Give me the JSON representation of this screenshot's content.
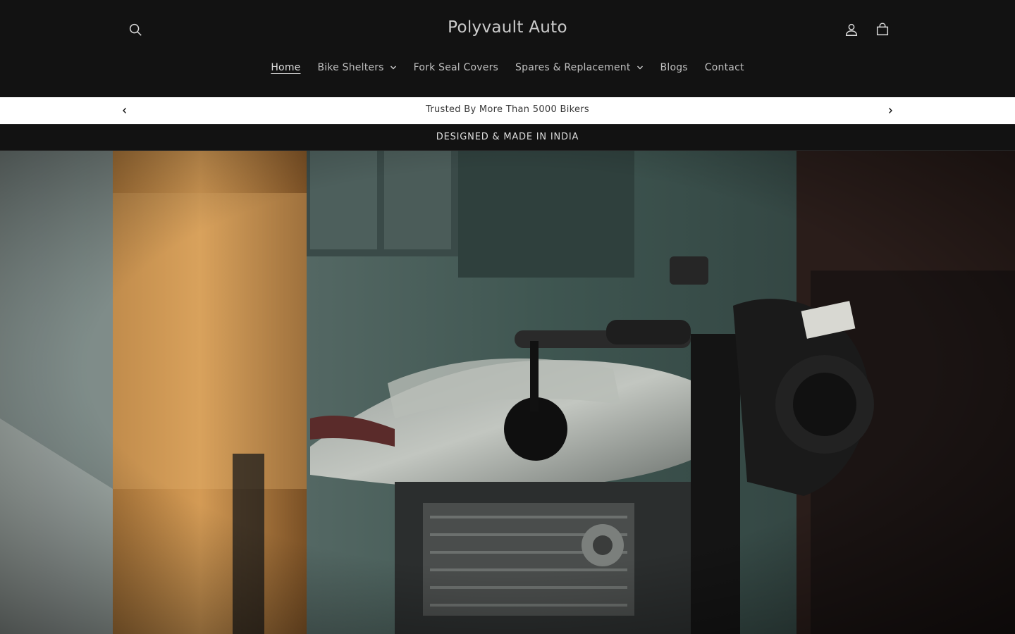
{
  "header": {
    "logo": "Polyvault Auto",
    "nav": [
      {
        "label": "Home",
        "active": true,
        "dropdown": false
      },
      {
        "label": "Bike Shelters",
        "active": false,
        "dropdown": true
      },
      {
        "label": "Fork Seal Covers",
        "active": false,
        "dropdown": false
      },
      {
        "label": "Spares & Replacement",
        "active": false,
        "dropdown": true
      },
      {
        "label": "Blogs",
        "active": false,
        "dropdown": false
      },
      {
        "label": "Contact",
        "active": false,
        "dropdown": false
      }
    ],
    "icons": {
      "search": "search-icon",
      "account": "account-icon",
      "cart": "cart-icon"
    }
  },
  "announcement_bar": {
    "text": "Trusted By More Than 5000 Bikers"
  },
  "secondary_bar": {
    "text": "DESIGNED & MADE IN INDIA"
  },
  "colors": {
    "header_bg": "#121212",
    "announcement_bg": "#ffffff",
    "text_light": "#ffffff",
    "text_dark": "#121212"
  }
}
